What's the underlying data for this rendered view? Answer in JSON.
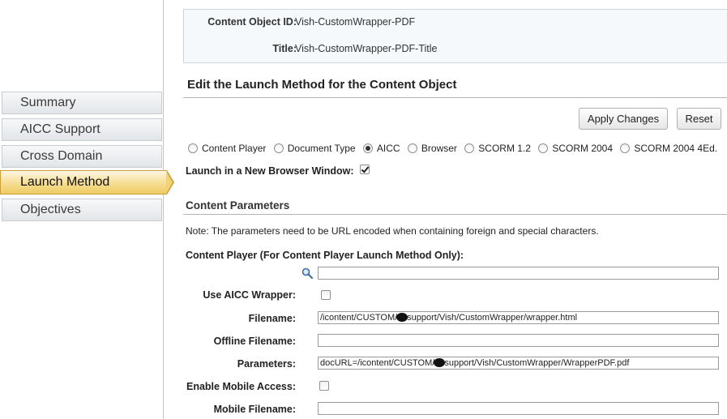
{
  "nav": {
    "items": [
      {
        "label": "Summary",
        "active": false
      },
      {
        "label": "AICC Support",
        "active": false
      },
      {
        "label": "Cross Domain",
        "active": false
      },
      {
        "label": "Launch Method",
        "active": true
      },
      {
        "label": "Objectives",
        "active": false
      }
    ]
  },
  "info": {
    "content_id_label": "Content Object ID:",
    "content_id_value": "Vish-CustomWrapper-PDF",
    "title_label": "Title:",
    "title_value": "Vish-CustomWrapper-PDF-Title"
  },
  "main": {
    "section_title": "Edit the Launch Method for the Content Object",
    "apply_label": "Apply Changes",
    "reset_label": "Reset",
    "launch_methods": [
      {
        "label": "Content Player",
        "checked": false
      },
      {
        "label": "Document Type",
        "checked": false
      },
      {
        "label": "AICC",
        "checked": true
      },
      {
        "label": "Browser",
        "checked": false
      },
      {
        "label": "SCORM 1.2",
        "checked": false
      },
      {
        "label": "SCORM 2004",
        "checked": false
      },
      {
        "label": "SCORM 2004 4Ed.",
        "checked": false
      }
    ],
    "new_window_label": "Launch in a New Browser Window:",
    "new_window_checked": true
  },
  "params": {
    "title": "Content Parameters",
    "note": "Note: The parameters need to be URL encoded when containing foreign and special characters.",
    "player_label": "Content Player (For Content Player Launch Method Only):",
    "player_value": "",
    "aicc_wrapper_label": "Use AICC Wrapper:",
    "aicc_wrapper_checked": false,
    "filename_label": "Filename:",
    "filename_prefix": "/icontent/CUSTOM/",
    "filename_suffix": "support/Vish/CustomWrapper/wrapper.html",
    "offline_label": "Offline Filename:",
    "offline_value": "",
    "parameters_label": "Parameters:",
    "parameters_prefix": "docURL=/icontent/CUSTOM/",
    "parameters_suffix": "support/Vish/CustomWrapper/WrapperPDF.pdf",
    "mobile_access_label": "Enable Mobile Access:",
    "mobile_access_checked": false,
    "mobile_filename_label": "Mobile Filename:",
    "mobile_filename_value": ""
  },
  "colors": {
    "active_tab": "#f6dd91",
    "active_tab_border": "#c89d3a",
    "info_bg": "#f5f9fb"
  }
}
